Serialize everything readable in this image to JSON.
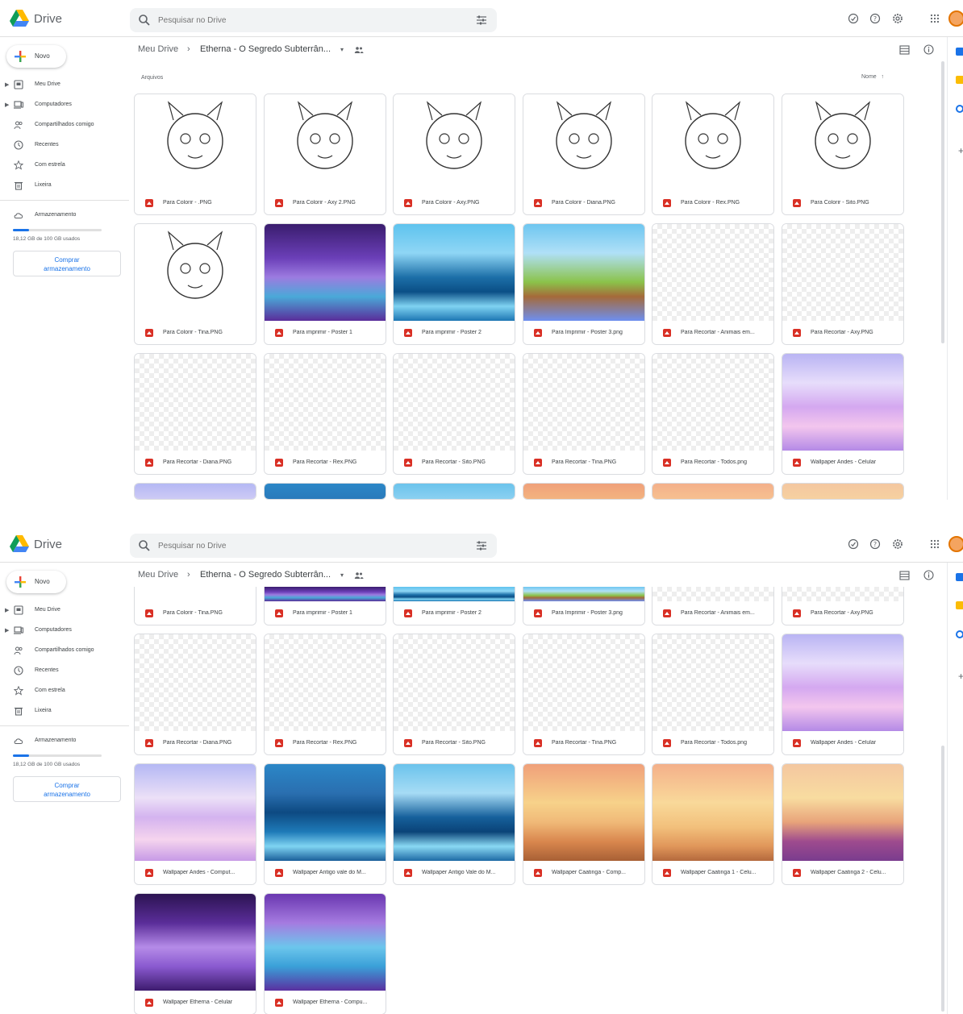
{
  "app": {
    "name": "Drive",
    "search_placeholder": "Pesquisar no Drive"
  },
  "colors": {
    "accent": "#1a73e8",
    "pdf_red": "#d93025",
    "border": "#dadce0"
  },
  "icons": {
    "header": [
      "search-icon",
      "filter-options-icon",
      "offline-status-icon",
      "help-icon",
      "settings-icon",
      "apps-grid-icon"
    ],
    "breadcrumb": [
      "chevron-right-icon",
      "dropdown-icon",
      "shared-folder-icon",
      "list-view-icon",
      "info-icon"
    ]
  },
  "sidebar": {
    "new_label": "Novo",
    "items": [
      {
        "label": "Meu Drive",
        "icon": "my-drive-icon",
        "expandable": true
      },
      {
        "label": "Computadores",
        "icon": "computer-icon",
        "expandable": true
      },
      {
        "label": "Compartilhados comigo",
        "icon": "shared-with-me-icon",
        "expandable": false
      },
      {
        "label": "Recentes",
        "icon": "clock-icon",
        "expandable": false
      },
      {
        "label": "Com estrela",
        "icon": "star-icon",
        "expandable": false
      },
      {
        "label": "Lixeira",
        "icon": "trash-icon",
        "expandable": false
      }
    ],
    "storage_label": "Armazenamento",
    "storage_used_text": "18,12 GB de 100 GB usados",
    "storage_fraction": 0.18,
    "buy_storage_line1": "Comprar",
    "buy_storage_line2": "armazenamento"
  },
  "breadcrumb": {
    "root": "Meu Drive",
    "separator": "›",
    "folder": "Etherna - O Segredo Subterrân...",
    "dropdown_glyph": "▾"
  },
  "content": {
    "section_title": "Arquivos",
    "sort_label": "Nome",
    "sort_arrow": "↑",
    "files": [
      {
        "name": "Para Colorir - .PNG",
        "thumb": "line"
      },
      {
        "name": "Para Colorir - Axy 2.PNG",
        "thumb": "line"
      },
      {
        "name": "Para Colorir - Axy.PNG",
        "thumb": "line"
      },
      {
        "name": "Para Colorir - Diana.PNG",
        "thumb": "line"
      },
      {
        "name": "Para Colorir - Rex.PNG",
        "thumb": "line"
      },
      {
        "name": "Para Colorir - Sito.PNG",
        "thumb": "line"
      },
      {
        "name": "Para Colorir - Tina.PNG",
        "thumb": "line"
      },
      {
        "name": "Para imprimir - Poster 1",
        "thumb": "cave"
      },
      {
        "name": "Para imprimir - Poster 2",
        "thumb": "lake"
      },
      {
        "name": "Para Imprimir - Poster 3.png",
        "thumb": "scene"
      },
      {
        "name": "Para Recortar - Animais em...",
        "thumb": "checker"
      },
      {
        "name": "Para Recortar - Axy.PNG",
        "thumb": "checker"
      },
      {
        "name": "Para Recortar - Diana.PNG",
        "thumb": "checker"
      },
      {
        "name": "Para Recortar - Rex.PNG",
        "thumb": "checker"
      },
      {
        "name": "Para Recortar - Sito.PNG",
        "thumb": "checker"
      },
      {
        "name": "Para Recortar - Tina.PNG",
        "thumb": "checker"
      },
      {
        "name": "Para Recortar - Todos.png",
        "thumb": "checker"
      },
      {
        "name": "Wallpaper Andes - Celular",
        "thumb": "andes"
      },
      {
        "name": "Wallpaper Andes - Comput...",
        "thumb": "andes-comp"
      },
      {
        "name": "Wallpaper Antigo vale do M...",
        "thumb": "antigo"
      },
      {
        "name": "Wallpaper Antigo Vale do M...",
        "thumb": "antigo2"
      },
      {
        "name": "Wallpaper Caatinga - Comp...",
        "thumb": "caatinga"
      },
      {
        "name": "Wallpaper Caatinga 1 - Celu...",
        "thumb": "caatinga2"
      },
      {
        "name": "Wallpaper Caatinga 2 - Celu...",
        "thumb": "caatinga3"
      },
      {
        "name": "Wallpaper Etherna - Celular",
        "thumb": "etherna"
      },
      {
        "name": "Wallpaper Etherna - Compu...",
        "thumb": "etherna2"
      }
    ]
  }
}
